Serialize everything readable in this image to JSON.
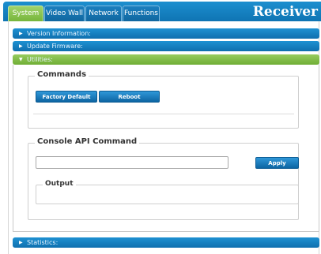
{
  "tabs": [
    {
      "label": "System",
      "active": true
    },
    {
      "label": "Video Wall",
      "active": false
    },
    {
      "label": "Network",
      "active": false
    },
    {
      "label": "Functions",
      "active": false
    }
  ],
  "brand": "Receiver",
  "accordions": {
    "version": "Version Information:",
    "firmware": "Update Firmware:",
    "utilities": "Utilities:",
    "statistics": "Statistics:"
  },
  "commands": {
    "legend": "Commands",
    "factory_default": "Factory Default",
    "reboot": "Reboot"
  },
  "console": {
    "legend": "Console API Command",
    "input_value": "",
    "apply": "Apply",
    "output_legend": "Output"
  },
  "icons": {
    "collapsed": "caret-right-icon",
    "expanded": "caret-down-icon"
  },
  "colors": {
    "header_blue": "#1184c8",
    "active_green": "#84c247"
  }
}
